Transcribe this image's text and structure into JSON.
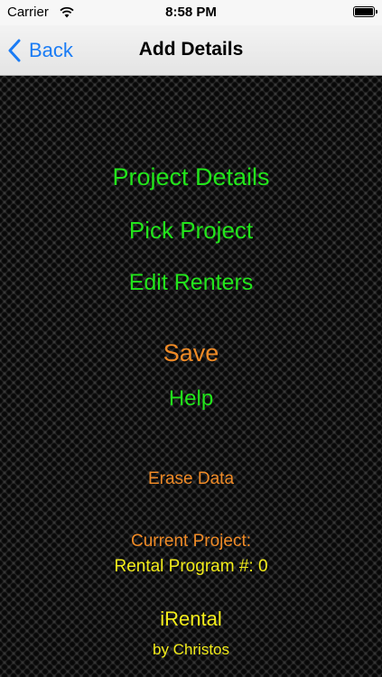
{
  "status_bar": {
    "carrier": "Carrier",
    "time": "8:58 PM",
    "wifi_icon": "wifi-icon",
    "battery_level": 1.0
  },
  "nav": {
    "back_label": "Back",
    "title": "Add Details"
  },
  "menu": {
    "project_details": "Project Details",
    "pick_project": "Pick Project",
    "edit_renters": "Edit Renters",
    "save": "Save",
    "help": "Help",
    "erase_data": "Erase Data"
  },
  "info": {
    "current_project_label": "Current Project:",
    "current_project_value": "Rental Program #: 0",
    "app_name": "iRental",
    "author": "by Christos"
  },
  "colors": {
    "accent_blue": "#1a7cf5",
    "menu_green": "#22e51b",
    "menu_orange": "#ef8a26",
    "info_yellow": "#f2ec1a"
  }
}
